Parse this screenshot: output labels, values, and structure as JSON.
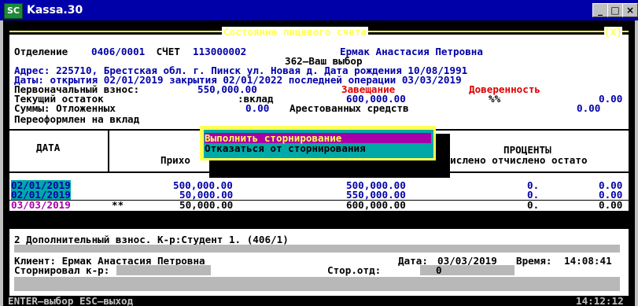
{
  "window": {
    "title": "Kassa.30",
    "icon": "SC",
    "controls": [
      "_",
      "□",
      "×"
    ]
  },
  "account": {
    "frame_title": "Состояние лицевого счета",
    "close_tag": "[X]",
    "l1_label": "Отделение ",
    "l1_branch": "0406/0001",
    "l1_account_label": " СЧЕТ ",
    "l1_account": "113000002",
    "l1_name": "Ермак Анастасия Петровна",
    "l2_choice": "362–Ваш выбор",
    "l3": "Адрес: 225710, Брестская обл. г. Пинск ул. Новая д. Дата рождения 10/08/1991",
    "l4": "Даты: открытия 02/01/2019 закрытия 02/01/2022 последней операции 03/03/2019",
    "l5_label": "Первоначальный взнос:",
    "l5_value": "550,000.00",
    "l5_will": "Завещание",
    "l5_proxy": "Доверенность",
    "l6_label": "Текущий остаток",
    "l6_deposit": ":вклад",
    "l6_value": "600,000.00",
    "l6_pct": "%%",
    "l6_pct_value": "0.00",
    "l7_label": "Суммы: Отложенных",
    "l7_value": "0.00",
    "l7_arrest": "Арестованных средств",
    "l7_arrest_value": "0.00",
    "l8_label": "Переоформлен на вклад"
  },
  "table": {
    "col_date": "ДАТА",
    "col_income": "Прихо",
    "col_percents": "ПРОЦЕНТЫ",
    "col_sub": "ачислено отчислено остато",
    "rows": [
      {
        "date": "02/01/2019",
        "mark": "",
        "income": "500,000.00",
        "balance": "500,000.00",
        "accr": "0.",
        "rest": "0.00"
      },
      {
        "date": "02/01/2019",
        "mark": "",
        "income": "50,000.00",
        "balance": "550,000.00",
        "accr": "0.",
        "rest": "0.00"
      },
      {
        "date": "03/03/2019",
        "mark": "**",
        "income": "50,000.00",
        "balance": "600,000.00",
        "accr": "0.",
        "rest": "0.00"
      }
    ]
  },
  "menu": {
    "items": [
      "Выполнить сторнирование",
      "Отказаться от сторнирования"
    ],
    "selected": 0
  },
  "detail": {
    "line1": "2 Дополнительный взнос. К-р:Студент 1. (406/1)",
    "client_label": "Клиент: Ермак Анастасия Петровна",
    "date_label": "Дата:",
    "date": "03/03/2019",
    "time_label": "Время:",
    "time": "14:08:41",
    "storno_label": "Сторнировал к-р:",
    "storno_branch_label": "Стор.отд:",
    "storno_branch": "0"
  },
  "status": {
    "keys": "ENTER–выбор ESC–выход",
    "clock": "14:12:12"
  },
  "colors": {
    "navy": "#0000a8",
    "teal": "#00a8a8",
    "magenta": "#a800a8",
    "yellow": "#ffff55",
    "red": "#e00000"
  }
}
